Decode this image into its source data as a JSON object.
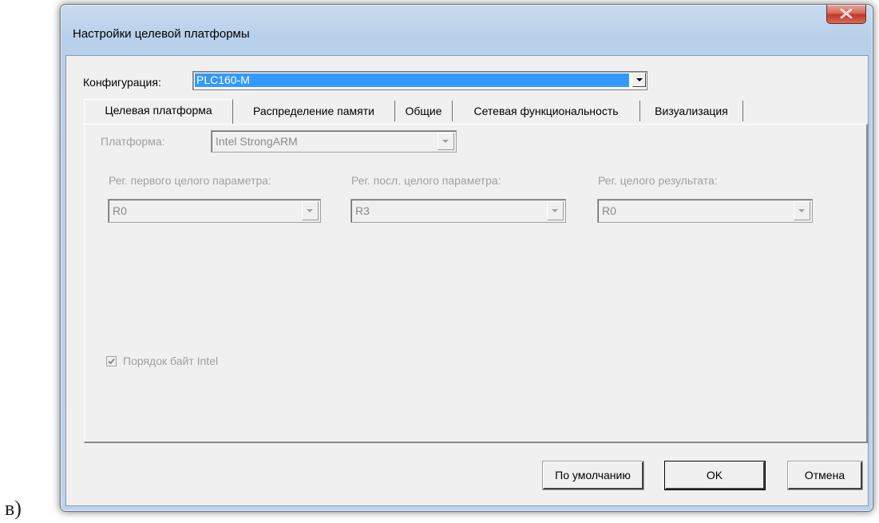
{
  "window": {
    "title": "Настройки целевой платформы"
  },
  "config": {
    "label": "Конфигурация:",
    "value": "PLC160-M"
  },
  "tabs": [
    {
      "label": "Целевая платформа",
      "active": true
    },
    {
      "label": "Распределение памяти",
      "active": false
    },
    {
      "label": "Общие",
      "active": false
    },
    {
      "label": "Сетевая функциональность",
      "active": false
    },
    {
      "label": "Визуализация",
      "active": false
    }
  ],
  "panel": {
    "platform_label": "Платформа:",
    "platform_value": "Intel StrongARM",
    "reg_first_label": "Рег. первого целого параметра:",
    "reg_first_value": "R0",
    "reg_last_label": "Рег. посл. целого параметра:",
    "reg_last_value": "R3",
    "reg_result_label": "Рег. целого результата:",
    "reg_result_value": "R0",
    "byte_order_label": "Порядок байт Intel",
    "byte_order_checked": true
  },
  "buttons": {
    "default_label": "По умолчанию",
    "ok_label": "OK",
    "cancel_label": "Отмена"
  },
  "figure_caption": "в)",
  "colors": {
    "selection": "#3399ff",
    "dialog_bg": "#f0f0f0",
    "close_button": "#c0392b"
  }
}
